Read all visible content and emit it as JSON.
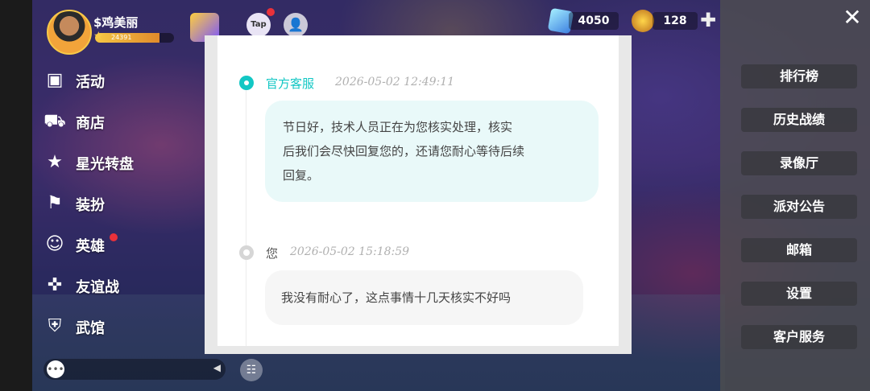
{
  "player": {
    "name": "$鸡美丽",
    "xp_value": "24391",
    "xp_progress": 0.82
  },
  "currency": {
    "gems": "4050",
    "coins": "128"
  },
  "icons": {
    "close": "close-icon",
    "add": "plus-icon",
    "tap": "Tap",
    "friend": "person-icon",
    "chat": "speech-bubble-icon",
    "emote": "emote-icon"
  },
  "left_menu": [
    {
      "label": "活动",
      "icon": "calendar-star-icon",
      "badge": false
    },
    {
      "label": "商店",
      "icon": "cart-icon",
      "badge": false
    },
    {
      "label": "星光转盘",
      "icon": "star-wheel-icon",
      "badge": false
    },
    {
      "label": "装扮",
      "icon": "hanger-icon",
      "badge": false
    },
    {
      "label": "英雄",
      "icon": "hero-icon",
      "badge": true
    },
    {
      "label": "友谊战",
      "icon": "gamepad-icon",
      "badge": false
    },
    {
      "label": "武馆",
      "icon": "dojo-icon",
      "badge": false
    }
  ],
  "right_menu": [
    "排行榜",
    "历史战绩",
    "录像厅",
    "派对公告",
    "邮箱",
    "设置",
    "客户服务"
  ],
  "dialog": {
    "messages": [
      {
        "sender": "官方客服",
        "time": "2026-05-02 12:49:11",
        "lines": [
          "节日好，技术人员正在为您核实处理，核实",
          "后我们会尽快回复您的，还请您耐心等待后续",
          "回复。"
        ]
      },
      {
        "sender": "您",
        "time": "2026-05-02 15:18:59",
        "lines": [
          "我没有耐心了，这点事情十几天核实不好吗"
        ]
      }
    ]
  },
  "colors": {
    "accent": "#12c7c4",
    "agent_bubble": "#e9f9f9",
    "user_bubble": "#f6f6f6",
    "red_dot": "#e9313a"
  }
}
